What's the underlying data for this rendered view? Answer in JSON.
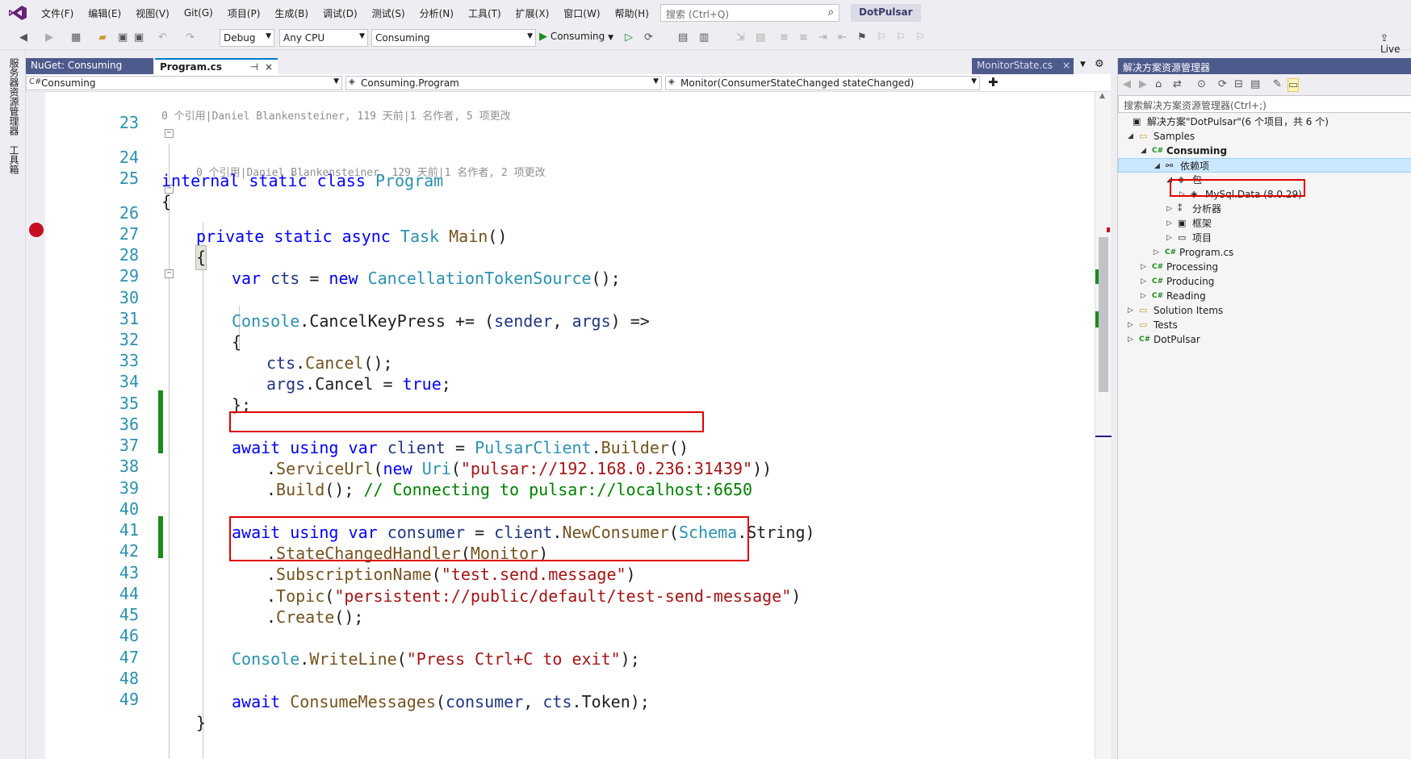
{
  "menu": {
    "items": [
      "文件(F)",
      "编辑(E)",
      "视图(V)",
      "Git(G)",
      "项目(P)",
      "生成(B)",
      "调试(D)",
      "测试(S)",
      "分析(N)",
      "工具(T)",
      "扩展(X)",
      "窗口(W)",
      "帮助(H)"
    ],
    "search_placeholder": "搜索 (Ctrl+Q)",
    "solution_name": "DotPulsar"
  },
  "toolbar": {
    "config": "Debug",
    "platform": "Any CPU",
    "startup_project": "Consuming",
    "run_label": "Consuming",
    "liveshare_label": "Live"
  },
  "left_strip": {
    "server_explorer": "服务器资源管理器",
    "toolbox": "工具箱"
  },
  "tabs": {
    "nuget": "NuGet: Consuming",
    "program": "Program.cs",
    "monitor": "MonitorState.cs",
    "pin_glyph": "⊣",
    "close_glyph": "×"
  },
  "navbar": {
    "project": "Consuming",
    "type": "Consuming.Program",
    "member": "Monitor(ConsumerStateChanged stateChanged)"
  },
  "code": {
    "lens1": "0 个引用|Daniel Blankensteiner, 119 天前|1 名作者, 5 项更改",
    "lens2": "0 个引用|Daniel Blankensteiner, 129 天前|1 名作者, 2 项更改",
    "line_numbers": [
      "23",
      "24",
      "25",
      "26",
      "27",
      "28",
      "29",
      "30",
      "31",
      "32",
      "33",
      "34",
      "35",
      "36",
      "37",
      "38",
      "39",
      "40",
      "41",
      "42",
      "43",
      "44",
      "45",
      "46",
      "47",
      "48",
      "49"
    ],
    "l24": {
      "a": "internal",
      "b": " ",
      "c": "static",
      "d": " ",
      "e": "class",
      "f": " ",
      "g": "Program"
    },
    "l25": "{",
    "l26": {
      "a": "private",
      "b": " ",
      "c": "static",
      "d": " ",
      "e": "async",
      "f": " ",
      "g": "Task",
      "h": " ",
      "i": "Main",
      "j": "()"
    },
    "l27": "{",
    "l28": {
      "a": "var",
      "b": " ",
      "c": "cts",
      "d": " = ",
      "e": "new",
      "f": " ",
      "g": "CancellationTokenSource",
      "h": "();"
    },
    "l30": {
      "a": "Console",
      "b": ".CancelKeyPress += (",
      "c": "sender",
      "d": ", ",
      "e": "args",
      "f": ") =>"
    },
    "l31": "{",
    "l32": {
      "a": "cts",
      "b": ".",
      "c": "Cancel",
      "d": "();"
    },
    "l33": {
      "a": "args",
      "b": ".Cancel = ",
      "c": "true",
      "d": ";"
    },
    "l34": "};",
    "l36": {
      "a": "await",
      "b": " ",
      "c": "using",
      "d": " ",
      "e": "var",
      "f": " ",
      "g": "client",
      "h": " = ",
      "i": "PulsarClient",
      "j": ".",
      "k": "Builder",
      "l": "()"
    },
    "l37": {
      "a": ".",
      "b": "ServiceUrl",
      "c": "(",
      "d": "new",
      "e": " ",
      "f": "Uri",
      "g": "(",
      "h": "\"pulsar://192.168.0.236:31439\"",
      "i": "))"
    },
    "l38": {
      "a": ".",
      "b": "Build",
      "c": "(); ",
      "d": "// Connecting to pulsar://localhost:6650"
    },
    "l40": {
      "a": "await",
      "b": " ",
      "c": "using",
      "d": " ",
      "e": "var",
      "f": " ",
      "g": "consumer",
      "h": " = ",
      "i": "client",
      "j": ".",
      "k": "NewConsumer",
      "l": "(",
      "m": "Schema",
      "n": ".String)"
    },
    "l41": {
      "a": ".",
      "b": "StateChangedHandler",
      "c": "(",
      "d": "Monitor",
      "e": ")"
    },
    "l42": {
      "a": ".",
      "b": "SubscriptionName",
      "c": "(",
      "d": "\"test.send.message\"",
      "e": ")"
    },
    "l43": {
      "a": ".",
      "b": "Topic",
      "c": "(",
      "d": "\"persistent://public/default/test-send-message\"",
      "e": ")"
    },
    "l44": {
      "a": ".",
      "b": "Create",
      "c": "();"
    },
    "l46": {
      "a": "Console",
      "b": ".",
      "c": "WriteLine",
      "d": "(",
      "e": "\"Press Ctrl+C to exit\"",
      "f": ");"
    },
    "l48": {
      "a": "await",
      "b": " ",
      "c": "ConsumeMessages",
      "d": "(",
      "e": "consumer",
      "f": ", ",
      "g": "cts",
      "h": ".Token);"
    },
    "l49": "}",
    "fold_glyph": "−"
  },
  "solution_explorer": {
    "title": "解决方案资源管理器",
    "search_placeholder": "搜索解决方案资源管理器(Ctrl+;)",
    "items": [
      {
        "label": "解决方案\"DotPulsar\"(6 个项目，共 6 个)",
        "exp": "",
        "icon": "▣"
      },
      {
        "label": "Samples",
        "exp": "◢",
        "icon": "▭"
      },
      {
        "label": "Consuming",
        "exp": "◢",
        "icon": "C#"
      },
      {
        "label": "依赖项",
        "exp": "◢",
        "icon": "⚯"
      },
      {
        "label": "包",
        "exp": "◢",
        "icon": "◈"
      },
      {
        "label": "MySql.Data (8.0.29)",
        "exp": "▷",
        "icon": "◈"
      },
      {
        "label": "分析器",
        "exp": "▷",
        "icon": "⁑"
      },
      {
        "label": "框架",
        "exp": "▷",
        "icon": "▣"
      },
      {
        "label": "项目",
        "exp": "▷",
        "icon": "▭"
      },
      {
        "label": "Program.cs",
        "exp": "▷",
        "icon": "C#"
      },
      {
        "label": "Processing",
        "exp": "▷",
        "icon": "C#"
      },
      {
        "label": "Producing",
        "exp": "▷",
        "icon": "C#"
      },
      {
        "label": "Reading",
        "exp": "▷",
        "icon": "C#"
      },
      {
        "label": "Solution Items",
        "exp": "▷",
        "icon": "▭"
      },
      {
        "label": "Tests",
        "exp": "▷",
        "icon": "▭"
      },
      {
        "label": "DotPulsar",
        "exp": "▷",
        "icon": "C#"
      }
    ]
  },
  "colors": {
    "accent": "#007acc",
    "tab_inactive": "#4d5a8c",
    "highlight_box": "#e00000",
    "change_bar": "#1b8b1b",
    "breakpoint": "#c50f1f"
  }
}
